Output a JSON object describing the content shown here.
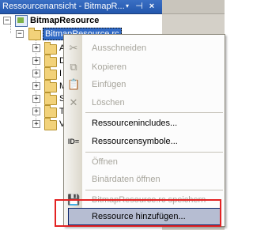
{
  "panel": {
    "title": "Ressourcenansicht - BitmapR...",
    "dropdown_glyph": "▾",
    "pin_glyph": "⊣",
    "close_glyph": "×"
  },
  "tree": {
    "root_label": "BitmapResource",
    "rc_label": "BitmapResource.rc",
    "children": [
      "A",
      "D",
      "I",
      "M",
      "S",
      "T",
      "V"
    ]
  },
  "menu": {
    "items": [
      {
        "label": "Ausschneiden",
        "enabled": false,
        "icon": "scissors-icon",
        "glyph": "✂"
      },
      {
        "label": "Kopieren",
        "enabled": false,
        "icon": "copy-icon",
        "glyph": "⧉"
      },
      {
        "label": "Einfügen",
        "enabled": false,
        "icon": "paste-icon",
        "glyph": "📋"
      },
      {
        "label": "Löschen",
        "enabled": false,
        "icon": "delete-icon",
        "glyph": "✕"
      },
      {
        "label": "Ressourcenincludes...",
        "enabled": true,
        "icon": "",
        "glyph": ""
      },
      {
        "label": "Ressourcensymbole...",
        "enabled": true,
        "icon": "id-icon",
        "glyph": "ID="
      },
      {
        "label": "Öffnen",
        "enabled": false,
        "icon": "",
        "glyph": ""
      },
      {
        "label": "Binärdaten öffnen",
        "enabled": false,
        "icon": "",
        "glyph": ""
      },
      {
        "label": "BitmapResource.rc speichern",
        "enabled": false,
        "icon": "save-icon",
        "glyph": "💾"
      },
      {
        "label": "Ressource hinzufügen...",
        "enabled": true,
        "icon": "",
        "glyph": "",
        "highlighted": true
      }
    ]
  },
  "colors": {
    "titlebar": "#2d63bb",
    "selection": "#316ac5",
    "highlight_box": "#e32222",
    "menu_hover": "#b6bdd2"
  }
}
